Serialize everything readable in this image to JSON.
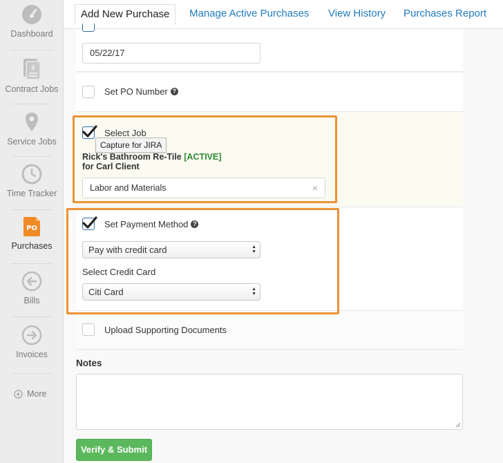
{
  "sidebar": {
    "items": [
      {
        "label": "Dashboard",
        "icon": "gauge-icon"
      },
      {
        "label": "Contract Jobs",
        "icon": "contract-icon"
      },
      {
        "label": "Service Jobs",
        "icon": "map-pin-icon"
      },
      {
        "label": "Time Tracker",
        "icon": "clock-icon"
      },
      {
        "label": "Purchases",
        "icon": "po-icon",
        "badge": "PO"
      },
      {
        "label": "Bills",
        "icon": "arrow-left-circle-icon"
      },
      {
        "label": "Invoices",
        "icon": "arrow-right-circle-icon"
      }
    ],
    "more_label": "More"
  },
  "tabs": [
    {
      "label": "Add New Purchase"
    },
    {
      "label": "Manage Active Purchases"
    },
    {
      "label": "View History"
    },
    {
      "label": "Purchases Report"
    }
  ],
  "form": {
    "date_value": "05/22/17",
    "po_number_label": "Set PO Number",
    "select_job_label": "Select Job",
    "tooltip": "Capture for JIRA",
    "job_name": "Rick's Bathroom Re-Tile",
    "job_status": "[ACTIVE]",
    "job_client": "for Carl Client",
    "job_category": "Labor and Materials",
    "clear_symbol": "×",
    "payment_method_label": "Set Payment Method",
    "payment_method_value": "Pay with credit card",
    "credit_card_label": "Select Credit Card",
    "credit_card_value": "Citi Card",
    "upload_label": "Upload Supporting Documents",
    "notes_label": "Notes",
    "submit_label": "Verify & Submit"
  },
  "colors": {
    "accent": "#1f7bc1",
    "highlight": "#ec9235",
    "po_badge": "#f08a24",
    "submit": "#5cb85c",
    "active_status": "#2e8b2e"
  }
}
